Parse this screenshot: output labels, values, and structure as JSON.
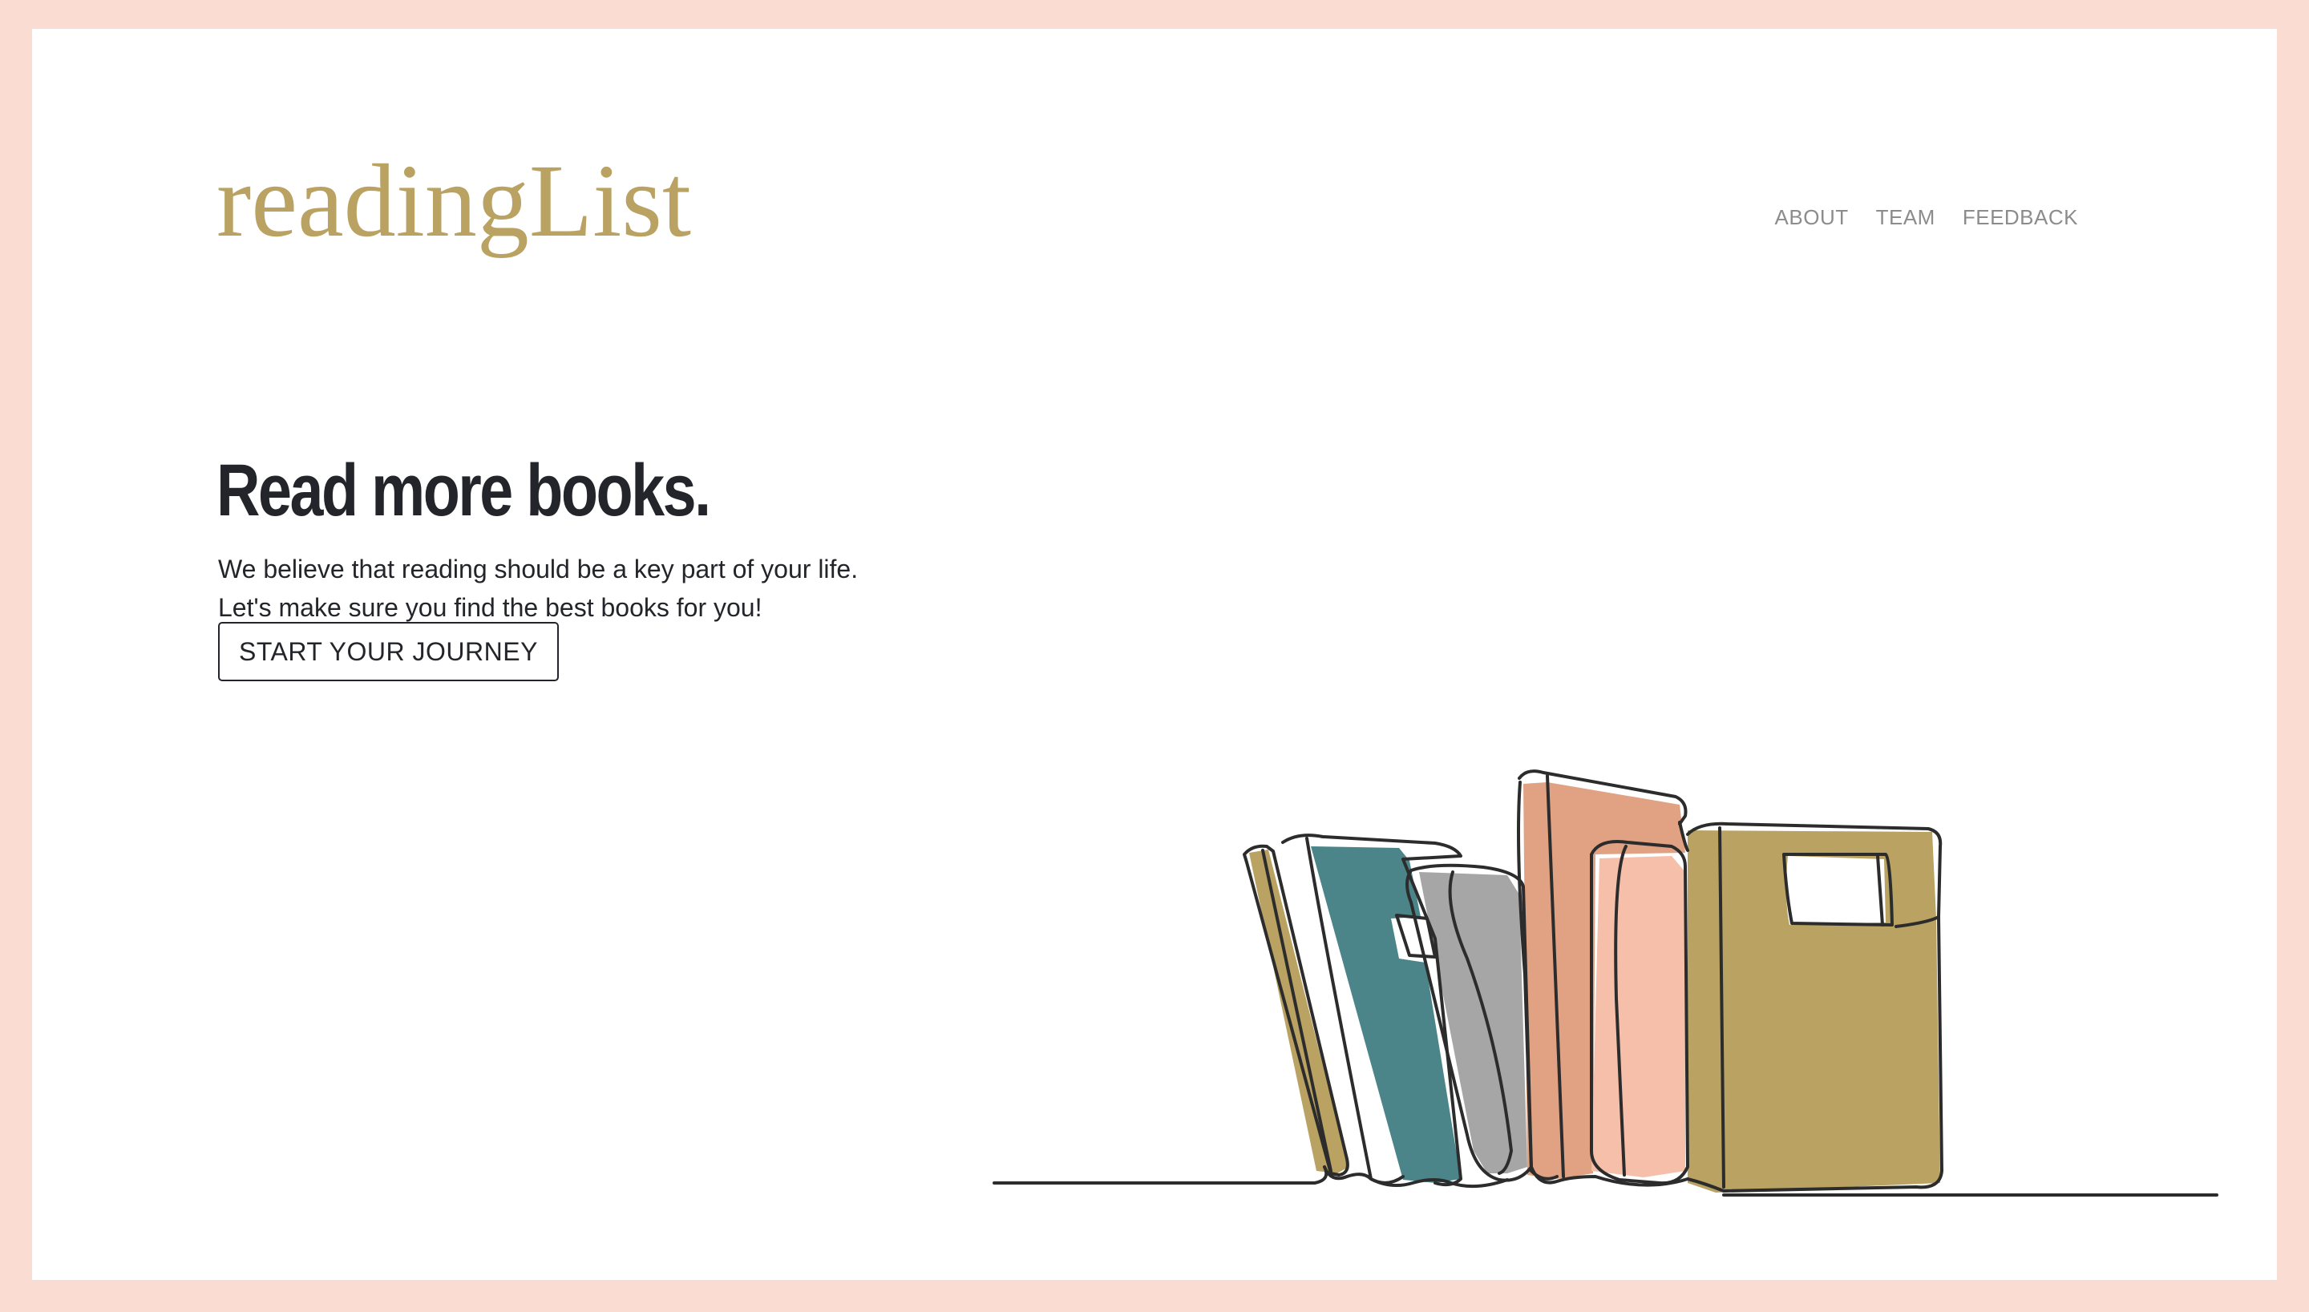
{
  "brand": {
    "logo_text": "readingList"
  },
  "nav": {
    "items": [
      {
        "label": "ABOUT"
      },
      {
        "label": "TEAM"
      },
      {
        "label": "FEEDBACK"
      }
    ]
  },
  "hero": {
    "title": "Read more books.",
    "line1": "We believe that reading should be a key part of your life.",
    "line2": "Let's make sure you find the best books for you!",
    "cta_label": "START YOUR JOURNEY"
  },
  "colors": {
    "background_border": "#fadcd3",
    "logo": "#b9a262",
    "text": "#23252a",
    "nav": "#8c8c8c",
    "book_olive": "#b9a262",
    "book_teal": "#4b858a",
    "book_gray": "#a6a6a6",
    "book_terracotta": "#e0a283",
    "book_pink": "#f5bfaa"
  },
  "illustration": {
    "icon": "books-line-art-icon"
  }
}
